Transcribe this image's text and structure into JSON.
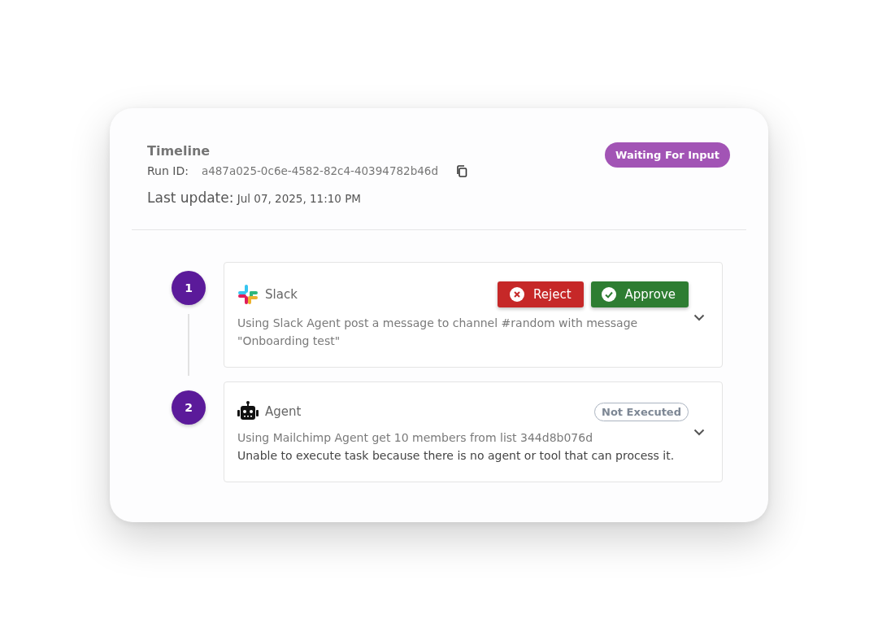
{
  "header": {
    "title": "Timeline",
    "run_id_label": "Run ID:",
    "run_id": "a487a025-0c6e-4582-82c4-40394782b46d",
    "last_update_label": "Last update:",
    "last_update": "Jul 07, 2025, 11:10 PM",
    "status": "Waiting For Input"
  },
  "steps": [
    {
      "number": "1",
      "kind": "slack",
      "name": "Slack",
      "description": "Using Slack Agent post a message to channel #random with message \"Onboarding test\"",
      "expanded": false,
      "actions": [
        {
          "kind": "reject",
          "label": "Reject"
        },
        {
          "kind": "approve",
          "label": "Approve"
        }
      ]
    },
    {
      "number": "2",
      "kind": "agent",
      "name": "Agent",
      "description": "Using Mailchimp Agent get 10 members from list 344d8b076d",
      "error": "Unable to execute task because there is no agent or tool that can process it.",
      "expanded": false,
      "status": "Not Executed"
    }
  ]
}
